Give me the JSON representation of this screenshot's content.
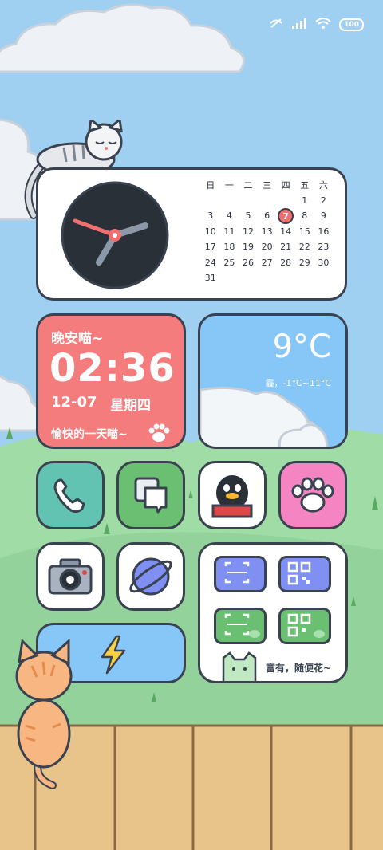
{
  "status_bar": {
    "battery": "100"
  },
  "calendar": {
    "weekdays": [
      "日",
      "一",
      "二",
      "三",
      "四",
      "五",
      "六"
    ],
    "weeks": [
      [
        "",
        "",
        "",
        "",
        "",
        "1",
        "2"
      ],
      [
        "3",
        "4",
        "5",
        "6",
        "7",
        "8",
        "9"
      ],
      [
        "10",
        "11",
        "12",
        "13",
        "14",
        "15",
        "16"
      ],
      [
        "17",
        "18",
        "19",
        "20",
        "21",
        "22",
        "23"
      ],
      [
        "24",
        "25",
        "26",
        "27",
        "28",
        "29",
        "30"
      ],
      [
        "31",
        "",
        "",
        "",
        "",
        "",
        ""
      ]
    ],
    "today": "7"
  },
  "time_widget": {
    "greeting": "晚安喵~",
    "time": "02:36",
    "date": "12-07",
    "weekday": "星期四",
    "slogan": "愉快的一天喵~"
  },
  "weather_widget": {
    "temperature": "9°C",
    "detail": "霾，-1°C~11°C"
  },
  "pay_widget": {
    "caption": "富有，随便花~"
  },
  "colors": {
    "sky": "#9fd0f2",
    "grass": "#9fdca6",
    "fence": "#e9c48a",
    "accent_red": "#f57c7c",
    "weather_blue": "#86c7f7",
    "phone_teal": "#62c3b3",
    "message_green": "#6bbf73",
    "paw_pink": "#f585c2",
    "alipay_blue": "#7f8ff2"
  },
  "icons": [
    "phone-icon",
    "messages-icon",
    "qq-penguin-icon",
    "paw-app-icon",
    "camera-icon",
    "browser-planet-icon",
    "lightning-icon",
    "scan-icon",
    "qr-code-icon",
    "cat-icon"
  ]
}
